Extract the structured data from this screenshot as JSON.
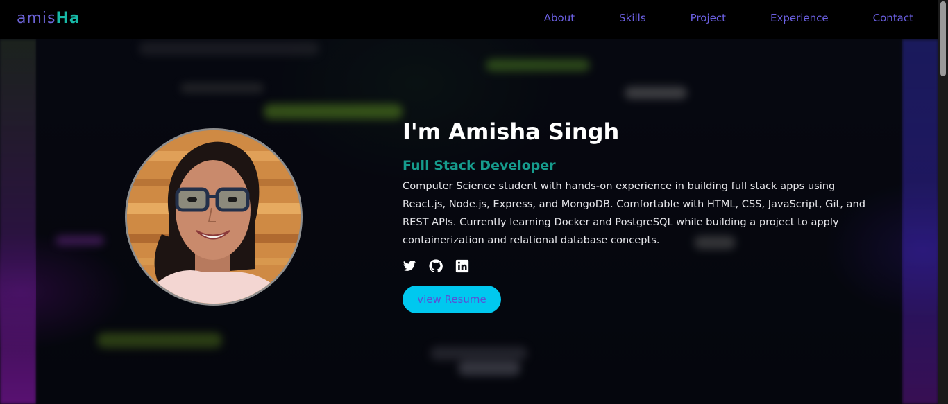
{
  "nav": {
    "logo_part1": "amis",
    "logo_part2": "Ha",
    "links": [
      {
        "label": "About"
      },
      {
        "label": "Skills"
      },
      {
        "label": "Project"
      },
      {
        "label": "Experience"
      },
      {
        "label": "Contact"
      }
    ]
  },
  "hero": {
    "title": "I'm Amisha Singh",
    "role": "Full Stack Developer",
    "description": "Computer Science student with hands-on experience in building full stack apps using React.js, Node.js, Express, and MongoDB. Comfortable with HTML, CSS, JavaScript, Git, and REST APIs. Currently learning Docker and PostgreSQL while building a project to apply containerization and relational database concepts.",
    "socials": [
      {
        "icon": "twitter-icon"
      },
      {
        "icon": "github-icon"
      },
      {
        "icon": "linkedin-icon"
      }
    ],
    "resume_label": "view Resume"
  },
  "colors": {
    "accent_teal": "#169c8d",
    "nav_link": "#6a5fe0",
    "button_bg": "#00c8ef"
  }
}
